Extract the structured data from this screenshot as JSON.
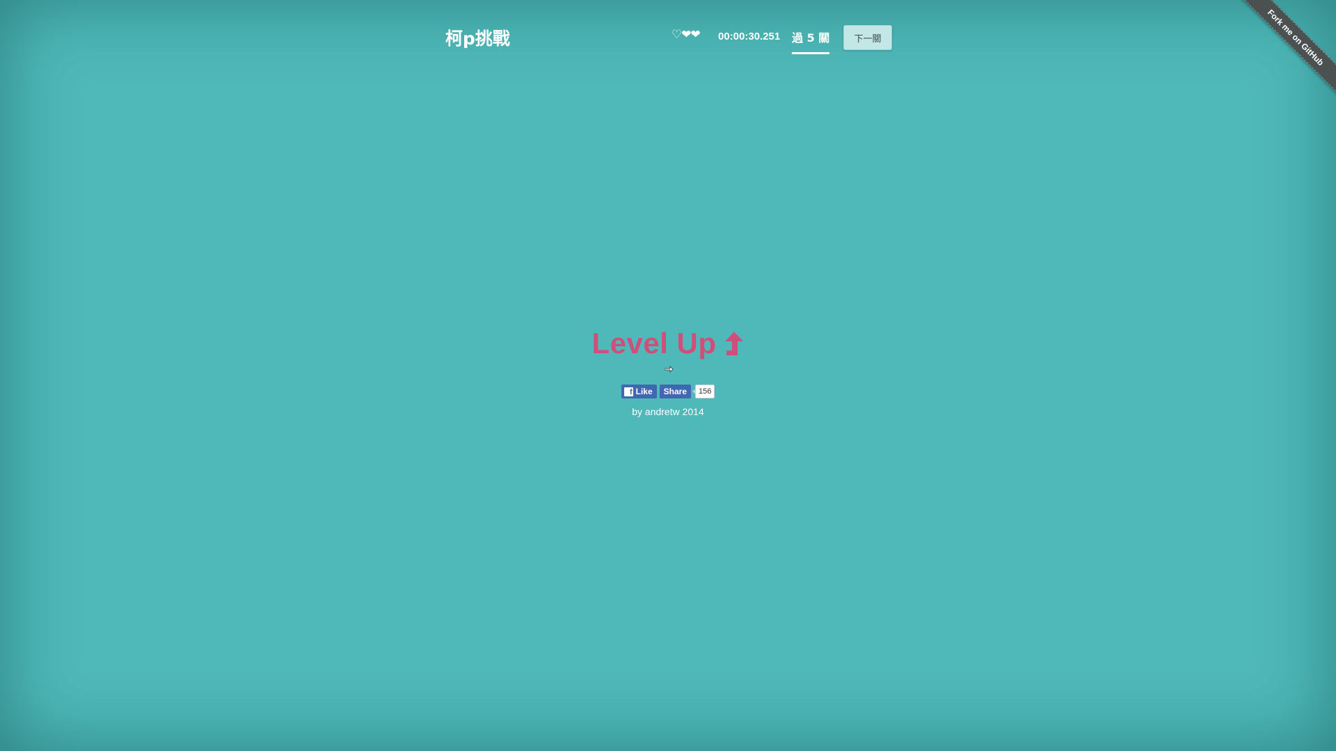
{
  "header": {
    "brand": "柯p挑戰",
    "hearts": "♡❤❤",
    "timer": "00:00:30.251",
    "level_tab": "過 5 關",
    "next_button": "下一關"
  },
  "ribbon": {
    "label": "Fork me on GitHub"
  },
  "main": {
    "title": "Level Up",
    "title_icon": "up-arrow-icon",
    "title_color": "#d04f7a"
  },
  "social": {
    "like_label": "Like",
    "share_label": "Share",
    "count": "156"
  },
  "footer": {
    "credit": "by andretw 2014"
  },
  "colors": {
    "background": "#4fb9b9",
    "facebook": "#4267b2",
    "ribbon": "#4b5050"
  }
}
